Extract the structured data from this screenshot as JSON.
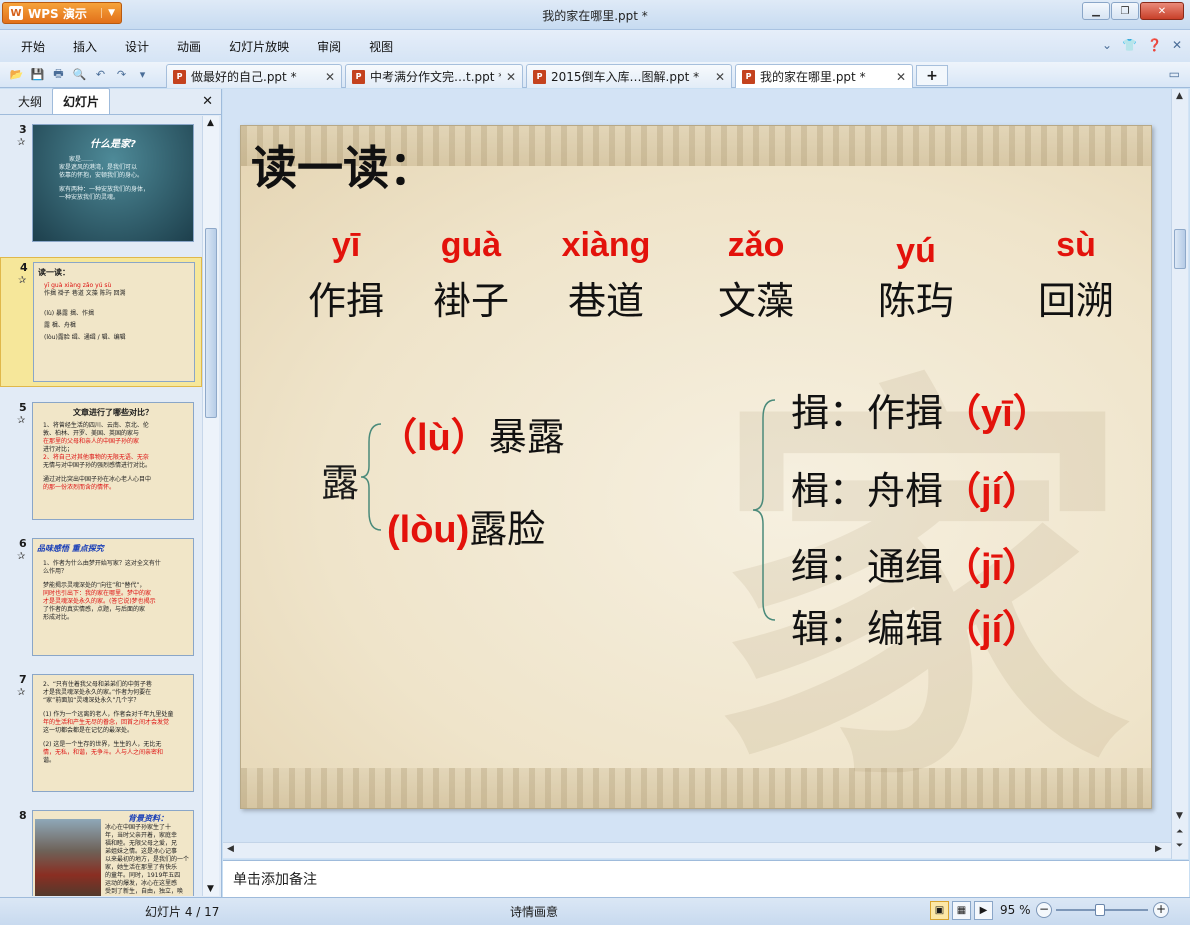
{
  "app": {
    "menu_label": "WPS 演示",
    "window_title": "我的家在哪里.ppt *"
  },
  "menu": [
    "开始",
    "插入",
    "设计",
    "动画",
    "幻灯片放映",
    "审阅",
    "视图"
  ],
  "tabs": [
    {
      "label": "做最好的自己.ppt *"
    },
    {
      "label": "中考满分作文完…t.ppt *"
    },
    {
      "label": "2015倒车入库…图解.ppt *"
    },
    {
      "label": "我的家在哪里.ppt *"
    }
  ],
  "left_panel": {
    "tab_outline": "大纲",
    "tab_slides": "幻灯片",
    "thumbs": [
      {
        "num": "3",
        "title": "什么是家?",
        "lines": [
          "家是……",
          "家是遮风的港湾，是我们可以",
          "依靠的怀抱，安顿我们的身心。",
          "家有两种：一种安放我们的身体，",
          "一种安放我们的灵魂。"
        ]
      },
      {
        "num": "4",
        "title": "读一读：",
        "lines": [
          "yī  guà  xiàng  zǎo  yú  sù",
          "作揖 褂子 巷道 文藻 陈玙 回溯",
          "(lù) 暴露    揖、作揖",
          "露          楫、舟楫",
          "(lòu)露脸   缉、通缉 / 辑、编辑"
        ]
      },
      {
        "num": "5",
        "title": "文章进行了哪些对比？",
        "lines": [
          "1、将曾经生活的四川、云南、京北、伦",
          "敦、柏林、开罗、美国、英国的家与",
          "在那里的父母和亲人的中国子孙的家",
          "进行对比；",
          "2、将自己对其他事物的无限无语、无奈",
          "无情与对中国子孙的强烈感情进行对比。",
          "通过对比突出中国子孙在冰心老人心目中",
          "的那一份浓烈而含的情怀。"
        ]
      },
      {
        "num": "6",
        "title": "品味感悟   重点探究",
        "lines": [
          "1、作者为什么由梦开始写家？这对全文有什",
          "么作用？",
          "梦能揭示灵魂深处的“向往”和“替代”，",
          "同时也引出下：我的家在哪里。梦中的家",
          "才是灵魂深处永久的家。(答它说)梦也揭示",
          "了作者的真实情感，点题，与后面的家",
          "形成对比。"
        ]
      },
      {
        "num": "7",
        "title": "",
        "lines": [
          "2、“只有住着我父母和弟弟们的中剪子巷",
          "才是我灵魂深处永久的家。”作者为何要在",
          "“家”前面加“灵魂深处永久”几个字？",
          "(1) 作为一个远离的老人，作者会对千年九里处童",
          "年的生活和产生无尽的眷念，回首之间才会发觉",
          "这一切都会都是在记忆的最深处。",
          "(2) 这是一个生存的世界，生生的人，无比无",
          "情，无私，和谐，无争斗。人与人之间亲密和",
          "谐。"
        ]
      },
      {
        "num": "8",
        "title": "背景资料：",
        "lines": [
          "冰心在中国子孙家生了十",
          "年，当时父亲开着，家庭幸",
          "福和睦。无限父母之爱，兄",
          "弟姐妹之情。这是冰心记事",
          "以来最初的地方，是我们的一个",
          "家，她生活在那里了有快乐",
          "的童年。同时，1919年五四",
          "运动的爆发，冰心在这里感",
          "受到了新生，自由，独立，唤"
        ]
      }
    ]
  },
  "slide": {
    "heading": "读一读：",
    "words": [
      {
        "pinyin": "yī",
        "hanzi": "作揖"
      },
      {
        "pinyin": "guà",
        "hanzi": "褂子"
      },
      {
        "pinyin": "xiàng",
        "hanzi": "巷道"
      },
      {
        "pinyin": "zǎo",
        "hanzi": "文藻"
      },
      {
        "pinyin": "yú",
        "hanzi": "陈玙"
      },
      {
        "pinyin": "sù",
        "hanzi": "回溯"
      }
    ],
    "lu": {
      "char": "露",
      "readings": [
        {
          "pinyin": "（lù）",
          "word": "暴露"
        },
        {
          "pinyin": "(lòu)",
          "word": "露脸"
        }
      ]
    },
    "ji_group": [
      {
        "char": "揖：",
        "word": "作揖",
        "pinyin": "（yī）"
      },
      {
        "char": "楫：",
        "word": "舟楫",
        "pinyin": "（jí）"
      },
      {
        "char": "缉：",
        "word": "通缉",
        "pinyin": "（jī）"
      },
      {
        "char": "辑：",
        "word": "编辑",
        "pinyin": "（jí）"
      }
    ]
  },
  "notes_placeholder": "单击添加备注",
  "status": {
    "slide_counter": "幻灯片 4 / 17",
    "theme": "诗情画意",
    "zoom": "95 %"
  }
}
